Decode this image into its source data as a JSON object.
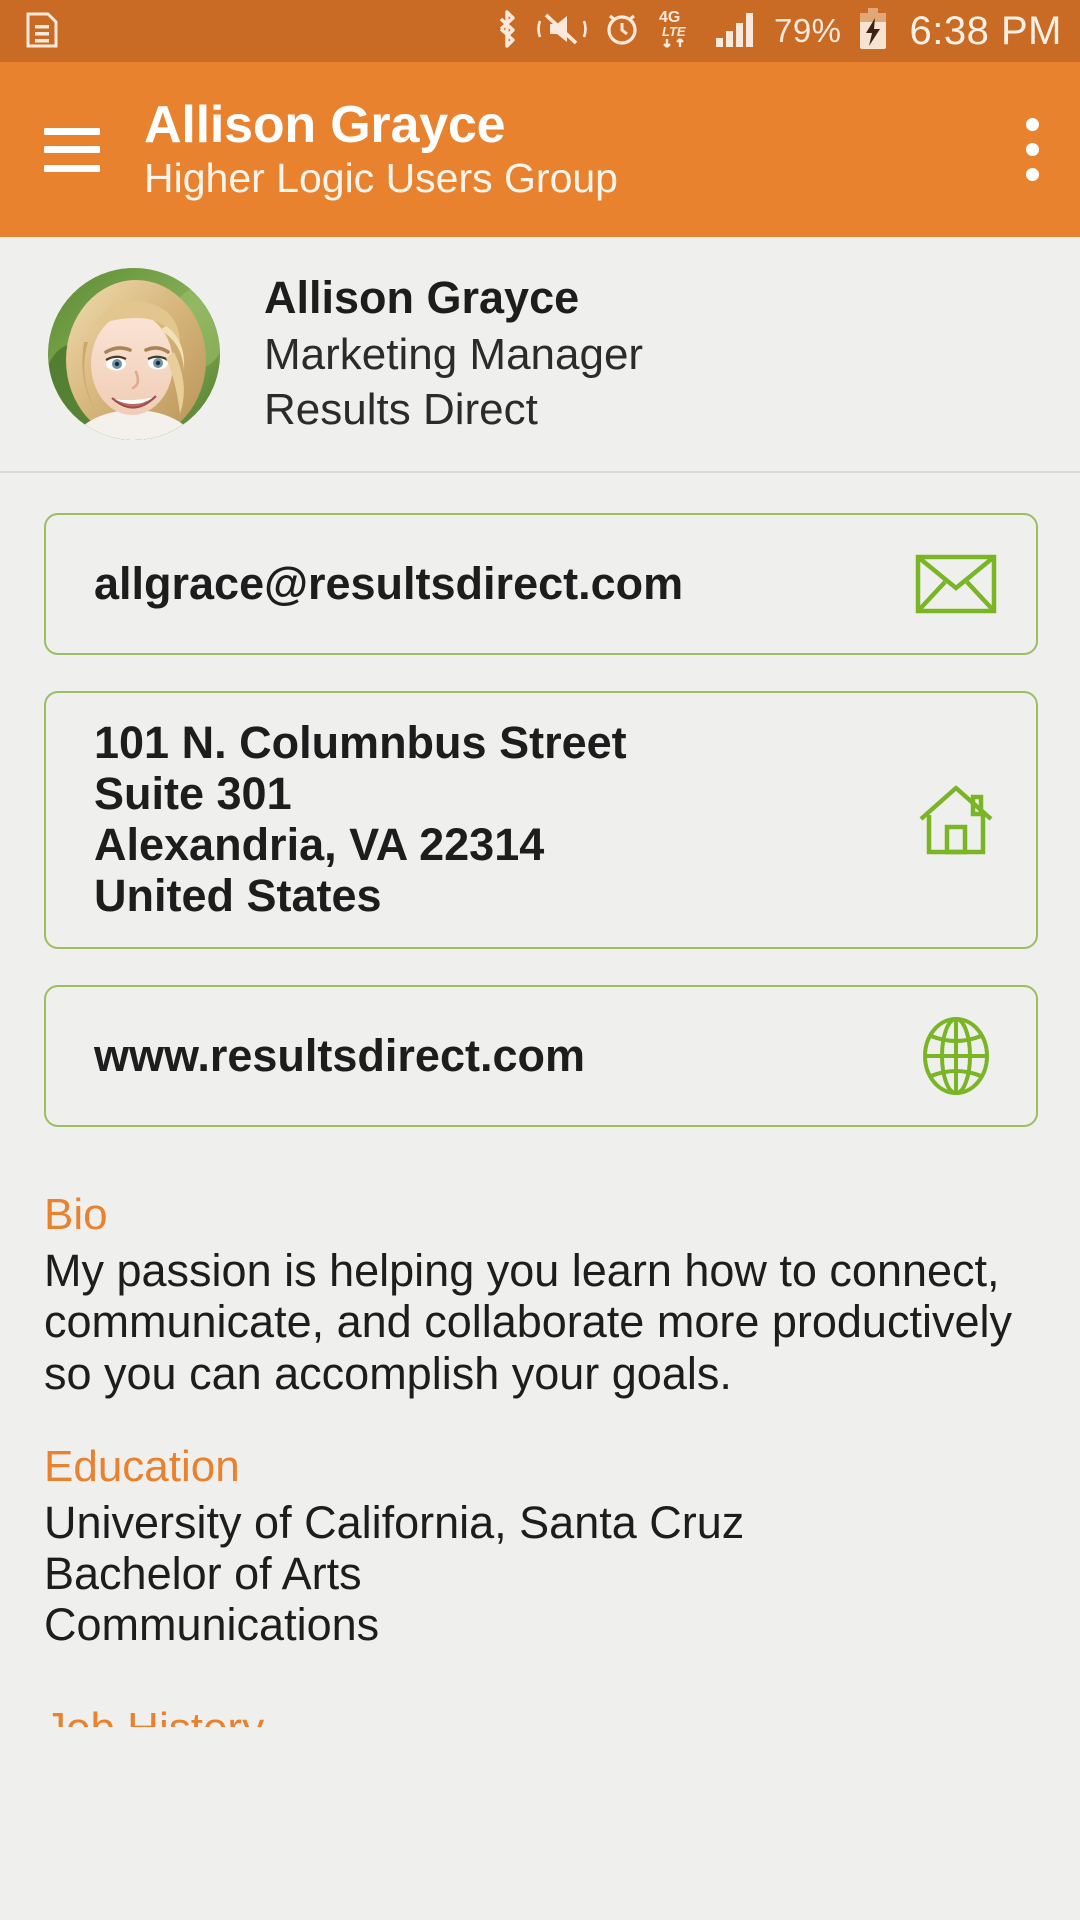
{
  "statusbar": {
    "battery_percent": "79%",
    "time": "6:38 PM",
    "icons": [
      "document-icon",
      "bluetooth-icon",
      "vibrate-mute-icon",
      "alarm-icon",
      "4g-lte-icon",
      "signal-bars-icon",
      "battery-charging-icon"
    ],
    "network_label_top": "4G",
    "network_label_bottom": "LTE",
    "background_color": "#c96a25"
  },
  "appbar": {
    "title": "Allison Grayce",
    "subtitle": "Higher Logic Users Group",
    "menu_icon": "hamburger-icon",
    "overflow_icon": "more-vertical-icon",
    "background_color": "#e8822f"
  },
  "profile": {
    "avatar_icon": "user-photo-avatar",
    "name": "Allison Grayce",
    "role": "Marketing Manager",
    "company": "Results Direct"
  },
  "contact_cards": [
    {
      "name": "email-card",
      "icon": "envelope-icon",
      "lines": [
        "allgrace@resultsdirect.com"
      ]
    },
    {
      "name": "address-card",
      "icon": "home-icon",
      "lines": [
        "101 N. Columnbus Street",
        "Suite 301",
        "Alexandria, VA 22314",
        "United States"
      ]
    },
    {
      "name": "website-card",
      "icon": "globe-icon",
      "lines": [
        "www.resultsdirect.com"
      ]
    }
  ],
  "sections": [
    {
      "name": "bio",
      "heading": "Bio",
      "lines": [
        "My passion is helping you learn how to connect,",
        "communicate, and collaborate more productively",
        "so you can accomplish your goals."
      ]
    },
    {
      "name": "education",
      "heading": "Education",
      "lines": [
        "University of California, Santa Cruz",
        "Bachelor of Arts",
        "Communications"
      ]
    }
  ],
  "clipped_section": {
    "heading": "Job History"
  },
  "colors": {
    "accent_orange": "#e8822f",
    "status_orange": "#c96a25",
    "accent_green": "#7ab526",
    "card_border_green": "#9bbd63",
    "page_background": "#efefee",
    "text_primary": "#1d1d1d"
  }
}
